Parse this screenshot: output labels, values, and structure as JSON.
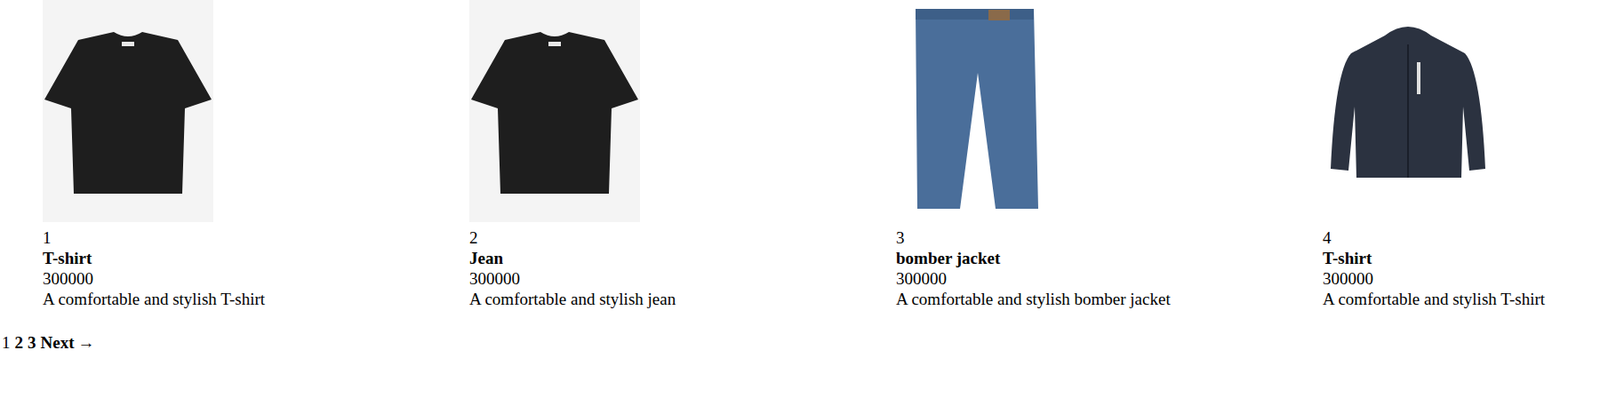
{
  "products": [
    {
      "id": "1",
      "name": "T-shirt",
      "price": "300000",
      "description": "A comfortable and stylish T-shirt",
      "kind": "tshirt"
    },
    {
      "id": "2",
      "name": "Jean",
      "price": "300000",
      "description": "A comfortable and stylish jean",
      "kind": "tshirt"
    },
    {
      "id": "3",
      "name": "bomber jacket",
      "price": "300000",
      "description": "A comfortable and stylish bomber jacket",
      "kind": "jeans"
    },
    {
      "id": "4",
      "name": "T-shirt",
      "price": "300000",
      "description": "A comfortable and stylish T-shirt",
      "kind": "jacket"
    }
  ],
  "pagination": {
    "pages": [
      {
        "label": "1",
        "selected": true
      },
      {
        "label": "2",
        "selected": false
      },
      {
        "label": "3",
        "selected": false
      }
    ],
    "next": {
      "label": "Next",
      "arrow": "→"
    }
  }
}
